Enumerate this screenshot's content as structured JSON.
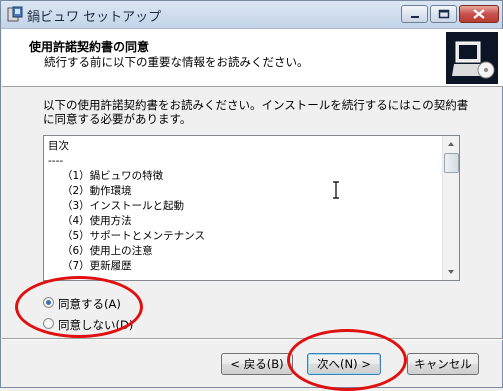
{
  "window": {
    "title": "鍋ビュワ セットアップ",
    "annotation_color": "#e01010"
  },
  "header": {
    "title": "使用許諾契約書の同意",
    "subtitle": "続行する前に以下の重要な情報をお読みください。"
  },
  "instruction": "以下の使用許諾契約書をお読みください。インストールを続行するにはこの契約書に同意する必要があります。",
  "license": {
    "lines": [
      "目次",
      "----",
      "（1）鍋ビュワの特徴",
      "（2）動作環境",
      "（3）インストールと起動",
      "（4）使用方法",
      "（5）サポートとメンテナンス",
      "（6）使用上の注意",
      "（7）更新履歴"
    ]
  },
  "options": {
    "agree": "同意する(A)",
    "disagree": "同意しない(D)",
    "selected": "agree"
  },
  "buttons": {
    "back": "< 戻る(B)",
    "next": "次へ(N) >",
    "cancel": "キャンセル"
  }
}
